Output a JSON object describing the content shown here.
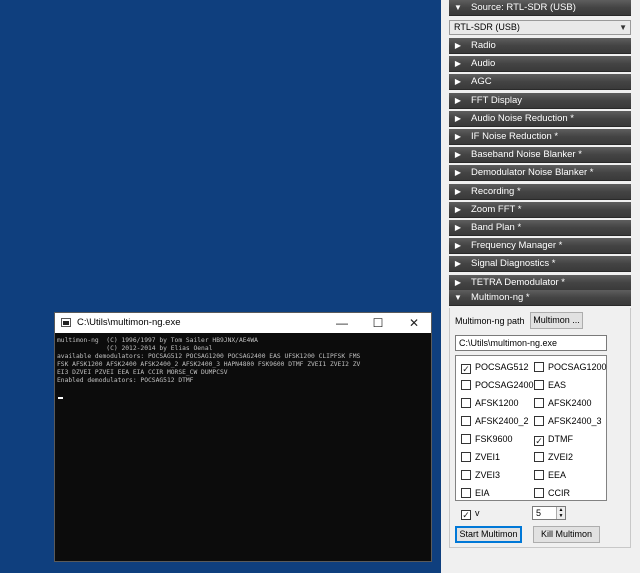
{
  "panel": {
    "source_header": "Source: RTL-SDR (USB)",
    "source_select": "RTL-SDR (USB)",
    "sections": [
      "Radio",
      "Audio",
      "AGC",
      "FFT Display",
      "Audio Noise Reduction *",
      "IF Noise Reduction *",
      "Baseband Noise Blanker *",
      "Demodulator Noise Blanker *",
      "Recording *",
      "Zoom FFT *",
      "Band Plan *",
      "Frequency Manager *",
      "Signal Diagnostics *",
      "TETRA Demodulator *"
    ],
    "collapsed_arrow": "▶",
    "expanded_arrow": "▼"
  },
  "multimon": {
    "header": "Multimon-ng *",
    "path_label": "Multimon-ng path",
    "browse_label": "Multimon ...",
    "path_value": "C:\\Utils\\multimon-ng.exe",
    "demodulators": [
      {
        "name": "POCSAG512",
        "checked": true
      },
      {
        "name": "POCSAG1200",
        "checked": false
      },
      {
        "name": "POCSAG2400",
        "checked": false
      },
      {
        "name": "EAS",
        "checked": false
      },
      {
        "name": "AFSK1200",
        "checked": false
      },
      {
        "name": "AFSK2400",
        "checked": false
      },
      {
        "name": "AFSK2400_2",
        "checked": false
      },
      {
        "name": "AFSK2400_3",
        "checked": false
      },
      {
        "name": "FSK9600",
        "checked": false
      },
      {
        "name": "DTMF",
        "checked": true
      },
      {
        "name": "ZVEI1",
        "checked": false
      },
      {
        "name": "ZVEI2",
        "checked": false
      },
      {
        "name": "ZVEI3",
        "checked": false
      },
      {
        "name": "EEA",
        "checked": false
      },
      {
        "name": "EIA",
        "checked": false
      },
      {
        "name": "CCIR",
        "checked": false
      }
    ],
    "verbose_label": "v",
    "verbose_checked": true,
    "verbose_level": "5",
    "start_label": "Start Multimon",
    "kill_label": "Kill Multimon"
  },
  "console": {
    "title": "C:\\Utils\\multimon-ng.exe",
    "minimize_glyph": "—",
    "maximize_glyph": "☐",
    "close_glyph": "✕",
    "lines": [
      "multimon-ng  (C) 1996/1997 by Tom Sailer HB9JNX/AE4WA",
      "             (C) 2012-2014 by Elias Oenal",
      "available demodulators: POCSAG512 POCSAG1200 POCSAG2400 EAS UFSK1200 CLIPFSK FMS",
      "FSK AFSK1200 AFSK2400 AFSK2400_2 AFSK2400_3 HAPN4800 FSK9600 DTMF ZVEI1 ZVEI2 ZV",
      "EI3 DZVEI PZVEI EEA EIA CCIR MORSE_CW DUMPCSV",
      "Enabled demodulators: POCSAG512 DTMF"
    ]
  }
}
